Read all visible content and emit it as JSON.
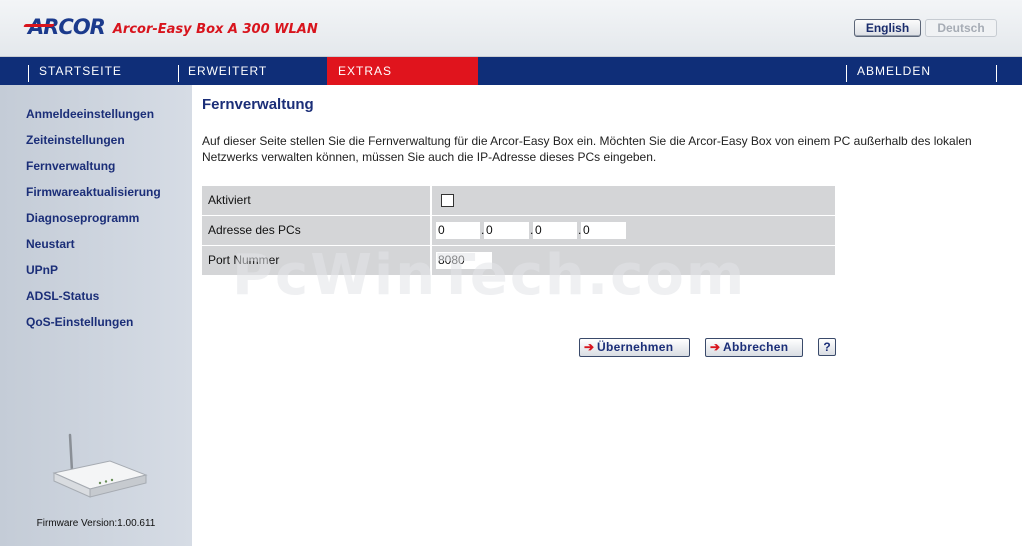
{
  "header": {
    "logo_text": "ARCOR",
    "product_name": "Arcor-Easy Box A 300 WLAN",
    "lang_english": "English",
    "lang_deutsch": "Deutsch"
  },
  "nav": {
    "startseite": "STARTSEITE",
    "erweitert": "ERWEITERT",
    "extras": "EXTRAS",
    "abmelden": "ABMELDEN"
  },
  "sidebar": {
    "items": [
      {
        "label": "Anmeldeeinstellungen"
      },
      {
        "label": "Zeiteinstellungen"
      },
      {
        "label": "Fernverwaltung"
      },
      {
        "label": "Firmwareaktualisierung"
      },
      {
        "label": "Diagnoseprogramm"
      },
      {
        "label": "Neustart"
      },
      {
        "label": "UPnP"
      },
      {
        "label": "ADSL-Status"
      },
      {
        "label": "QoS-Einstellungen"
      }
    ],
    "firmware": "Firmware Version:1.00.611"
  },
  "main": {
    "title": "Fernverwaltung",
    "description": "Auf dieser Seite stellen Sie die Fernverwaltung für die Arcor-Easy Box ein. Möchten Sie die Arcor-Easy Box von einem PC außerhalb des lokalen Netzwerks verwalten können, müssen Sie auch die IP-Adresse dieses PCs eingeben.",
    "rows": {
      "aktiviert_label": "Aktiviert",
      "aktiviert_checked": false,
      "adresse_label": "Adresse des PCs",
      "ip": [
        "0",
        "0",
        "0",
        "0"
      ],
      "ip_sep": ".",
      "port_label": "Port Nummer",
      "port_value": "8080"
    },
    "buttons": {
      "apply": "Übernehmen",
      "cancel": "Abbrechen",
      "help": "?",
      "arrow": "➔"
    }
  },
  "watermark": "PcWinTech.com",
  "colors": {
    "nav_bg": "#0f2e78",
    "nav_active": "#e0141d",
    "brand_red": "#d8141d",
    "brand_blue": "#1b2e78"
  }
}
